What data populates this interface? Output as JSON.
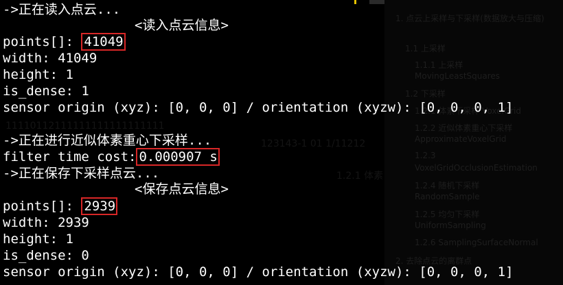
{
  "terminal": {
    "lines": {
      "l1": "->正在读入点云...",
      "l2": "<读入点云信息>",
      "l3_prefix": "points[]: ",
      "l3_value": "41049",
      "l4": "width: 41049",
      "l5": "height: 1",
      "l6": "is_dense: 1",
      "l7": "sensor origin (xyz): [0, 0, 0] / orientation (xyzw): [0, 0, 0, 1]",
      "l8": "->正在进行近似体素重心下采样...",
      "l9_prefix": "filter time cost:",
      "l9_value": "0.000907 s",
      "l10": "->正在保存下采样点云...",
      "l11": "<保存点云信息>",
      "l12_prefix": "points[]: ",
      "l12_value": "2939",
      "l13": "width: 2939",
      "l14": "height: 1",
      "l15": "is_dense: 0",
      "l16": "sensor origin (xyz): [0, 0, 0] / orientation (xyzw): [0, 0, 0, 1]"
    }
  },
  "background_toc": {
    "items": [
      "1. 点云上采样与下采样(数据放大与压缩)",
      "1.1 上采样",
      "1.1.1 上采样",
      "MovingLeastSquares",
      "1.2 下采样",
      "1.2.1 体素下采样 VoxelGrid",
      "1.2.2 近似体素重心下采样",
      "ApproximateVoxelGrid",
      "1.2.3",
      "VoxelGridOcclusionEstimation",
      "1.2.4 随机下采样",
      "RandomSample",
      "1.2.5 均匀下采样",
      "UniformSampling",
      "1.2.6 SamplingSurfaceNormal",
      "2. 去除点云的离群点"
    ],
    "mid_ghost_1": "11110112111111111111111111",
    "mid_ghost_2": "123143-1 01 1/11212",
    "mid_ghost_3": "1.2.1 体素"
  },
  "colors": {
    "background": "#000000",
    "text": "#ffffff",
    "highlight_box": "#d92727",
    "top_marks": [
      "#e6c300",
      "#444444",
      "#333333"
    ]
  }
}
